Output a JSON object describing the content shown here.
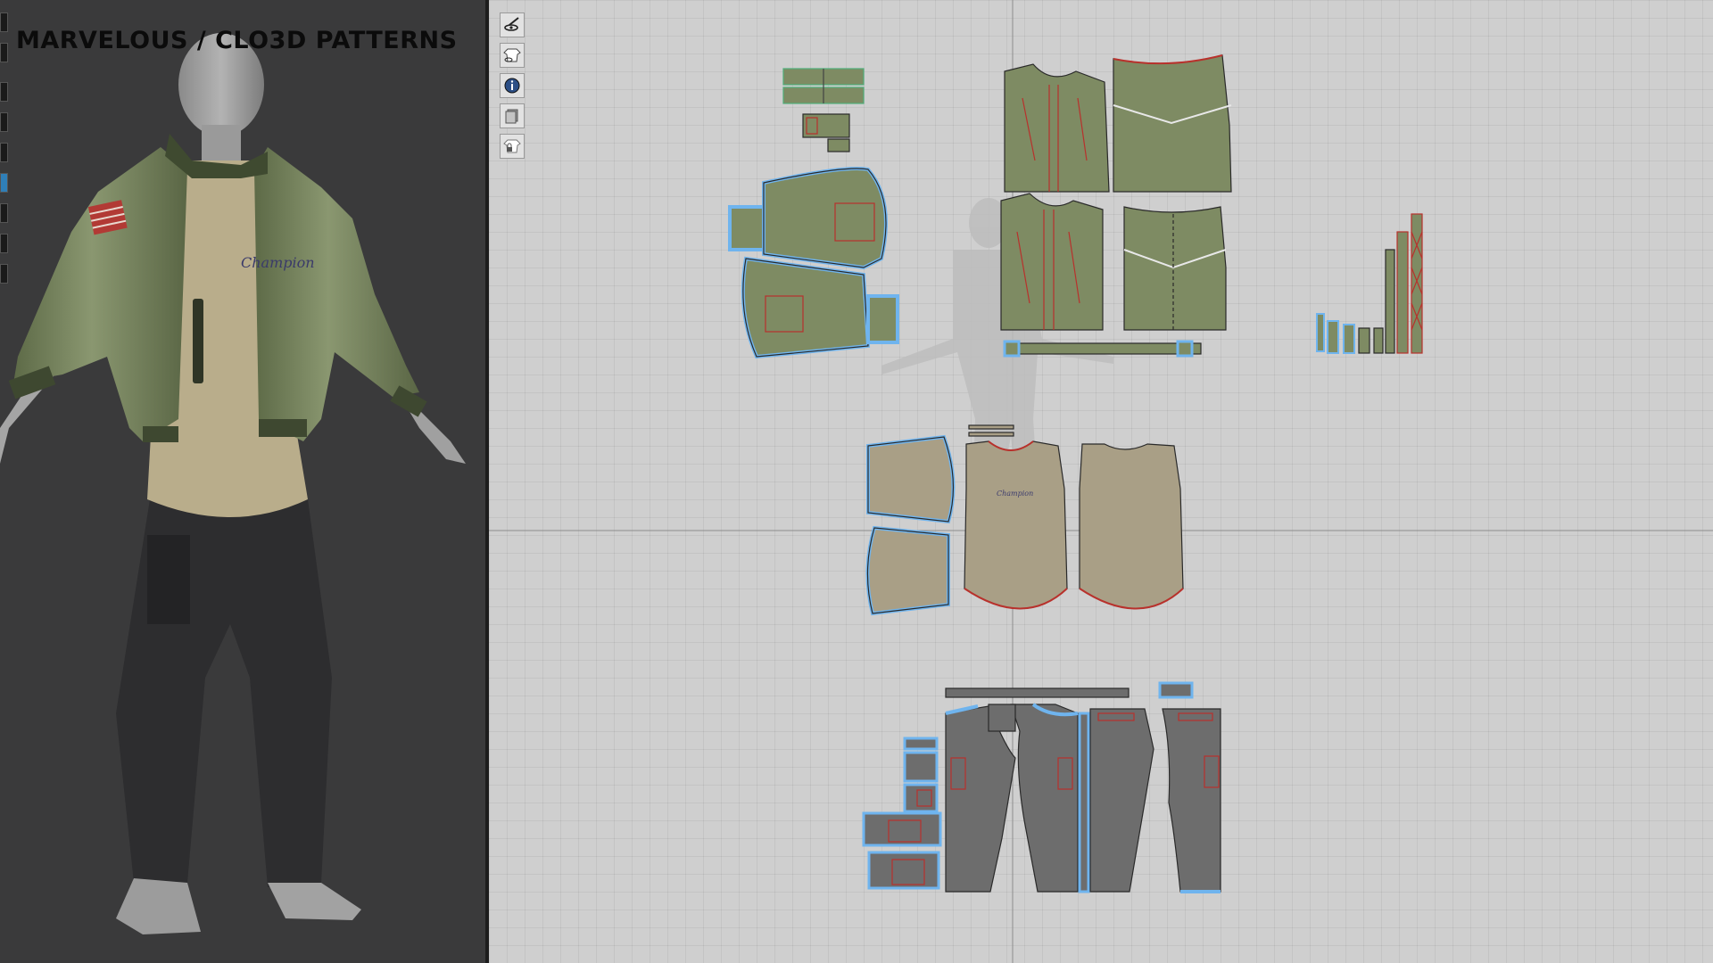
{
  "overlay": {
    "title": "MARVELOUS / CLO3D PATTERNS"
  },
  "left_toolbar": {
    "icons": [
      "select-icon",
      "transform-icon",
      "arrange-icon",
      "fold-icon",
      "pin-icon",
      "brush-icon",
      "measure-icon",
      "tape-icon",
      "sphere-icon"
    ]
  },
  "view2d_toolbar": {
    "icons": [
      "pen-visibility-icon",
      "garment-visibility-icon",
      "info-icon",
      "layer-icon",
      "lock-garment-icon"
    ]
  },
  "artwork": {
    "logo_text": "Champion"
  },
  "colors": {
    "background_3d": "#3a3a3b",
    "background_2d": "#cfcfcf",
    "jacket_fabric": "#7e8b63",
    "shirt_fabric": "#a99f86",
    "pants_fabric": "#6d6d6d",
    "selected_outline": "#6fb4ee",
    "seam_red": "#b8312c"
  }
}
